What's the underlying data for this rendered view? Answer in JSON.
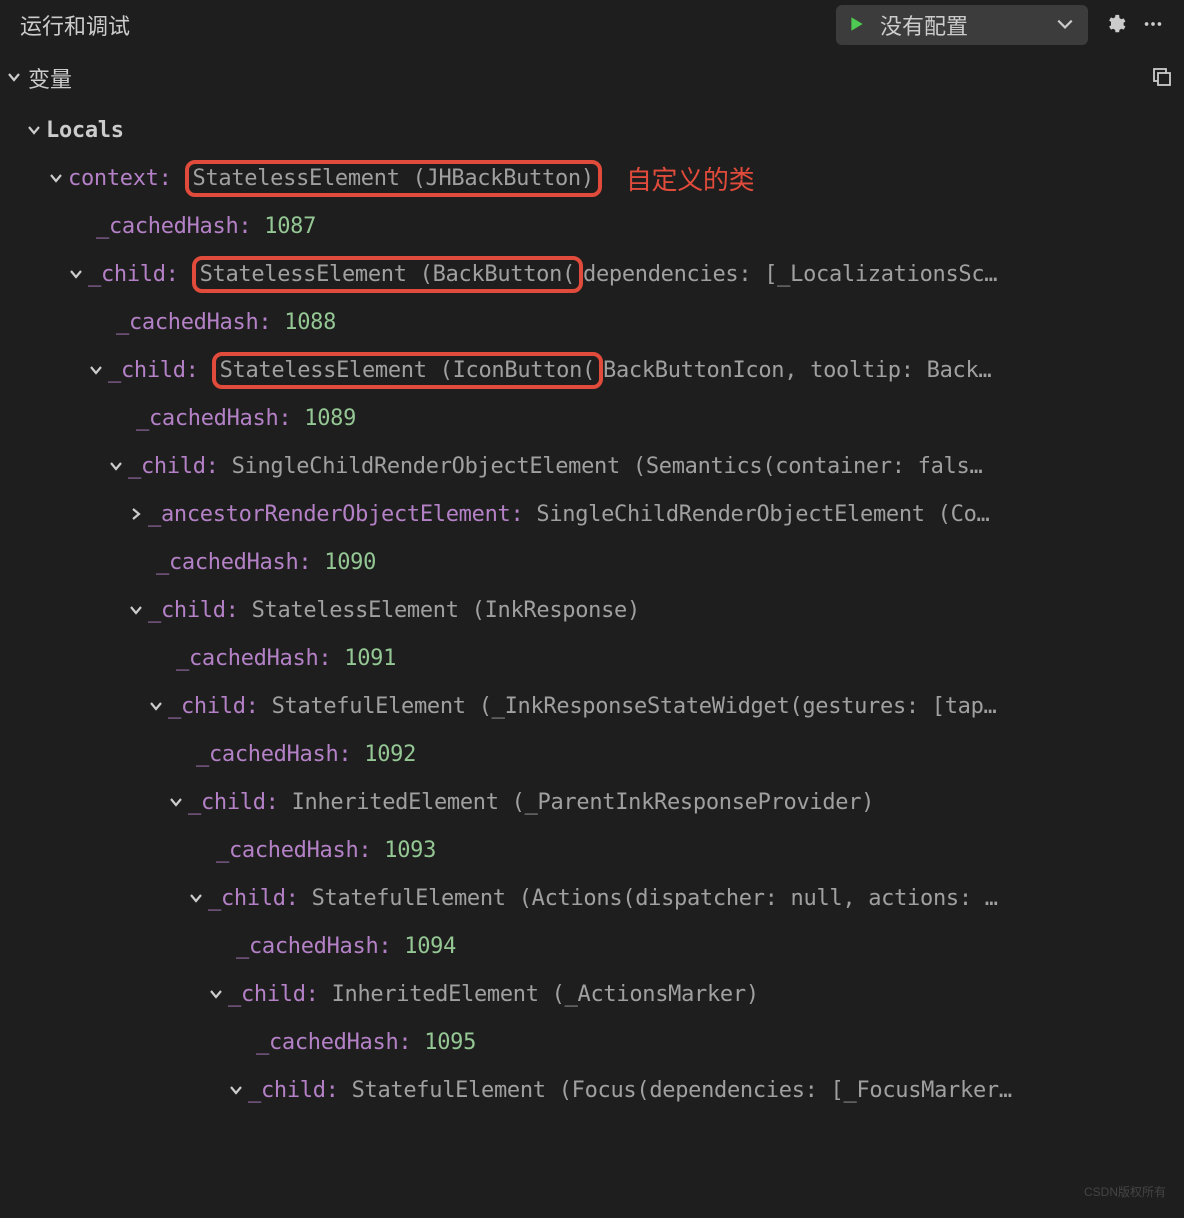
{
  "header": {
    "title": "运行和调试",
    "config_label": "没有配置"
  },
  "section": {
    "vars_title": "变量"
  },
  "annotation": "自定义的类",
  "tree": {
    "locals_label": "Locals",
    "context_key": "context:",
    "context_val": "StatelessElement (JHBackButton)",
    "cached_key": "_cachedHash:",
    "child_key": "_child:",
    "ancestor_key": "_ancestorRenderObjectElement:",
    "h1": "1087",
    "v2": "StatelessElement (BackButton(",
    "v2_tail": "dependencies: [_LocalizationsSc…",
    "h2": "1088",
    "v3": "StatelessElement (IconButton(",
    "v3_tail": "BackButtonIcon, tooltip: Back…",
    "h3": "1089",
    "v4": "SingleChildRenderObjectElement (Semantics(container: fals…",
    "ancestor_val": "SingleChildRenderObjectElement (Co…",
    "h4": "1090",
    "v5": "StatelessElement (InkResponse)",
    "h5": "1091",
    "v6": "StatefulElement (_InkResponseStateWidget(gestures: [tap…",
    "h6": "1092",
    "v7": "InheritedElement (_ParentInkResponseProvider)",
    "h7": "1093",
    "v8": "StatefulElement (Actions(dispatcher: null, actions: …",
    "h8": "1094",
    "v9": "InheritedElement (_ActionsMarker)",
    "h9": "1095",
    "v10": "StatefulElement (Focus(dependencies: [_FocusMarker…"
  },
  "watermark": "CSDN版权所有"
}
